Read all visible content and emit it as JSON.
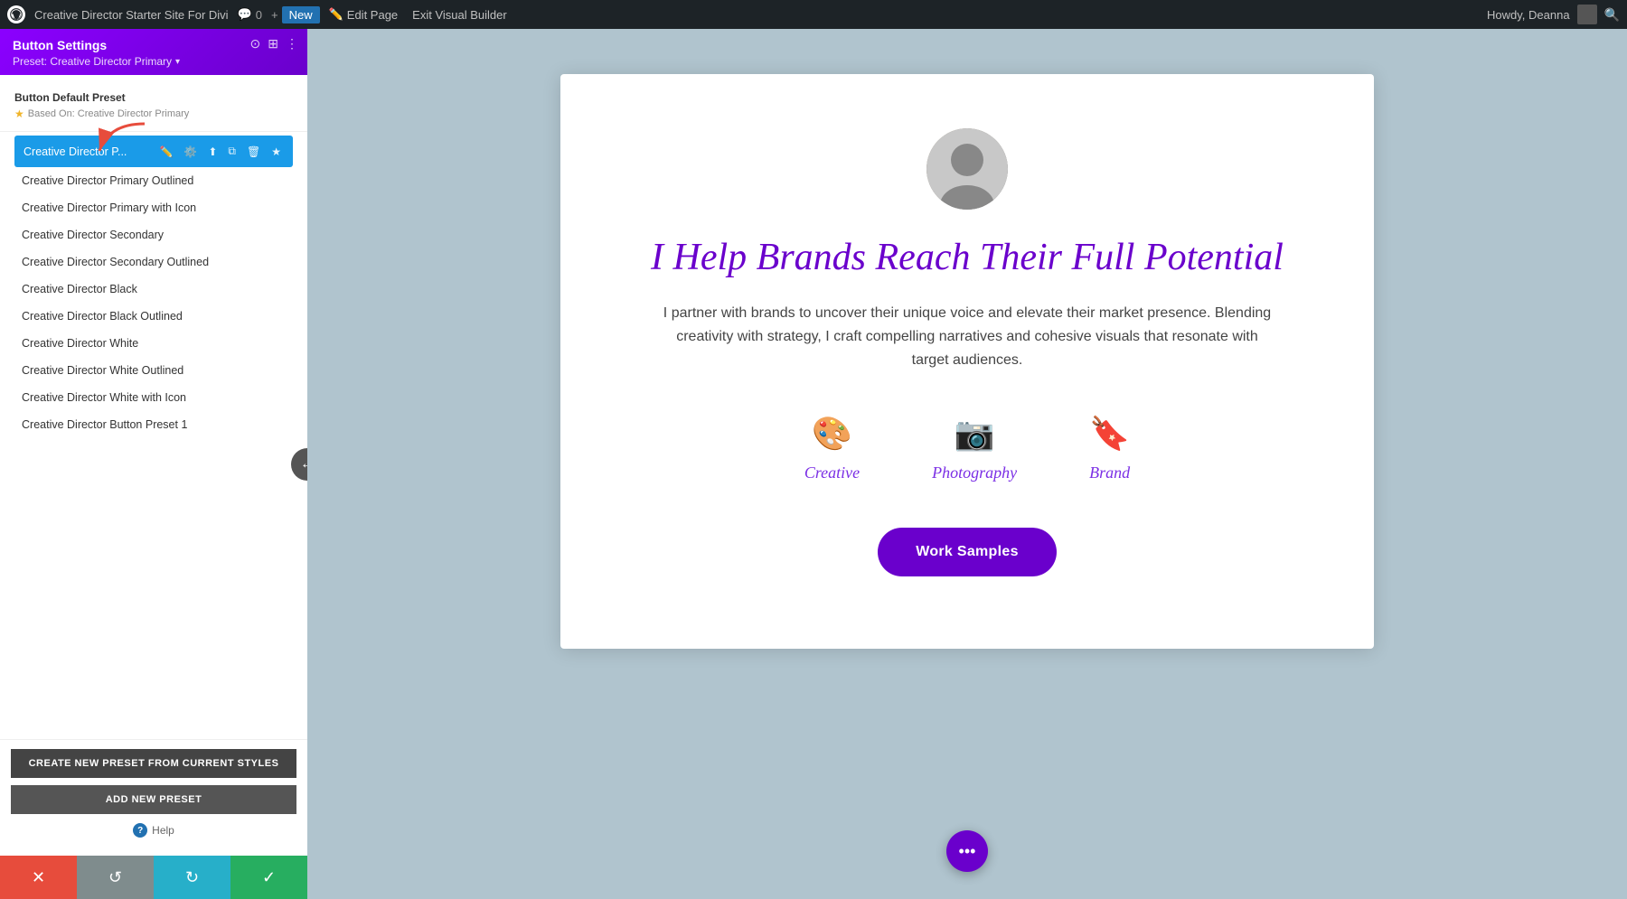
{
  "topbar": {
    "site_name": "Creative Director Starter Site For Divi",
    "comment_count": "0",
    "new_label": "New",
    "edit_page_label": "Edit Page",
    "exit_builder_label": "Exit Visual Builder",
    "howdy_label": "Howdy, Deanna",
    "search_icon": "🔍"
  },
  "panel": {
    "title": "Button Settings",
    "preset_label": "Preset: Creative Director Primary",
    "default_preset_heading": "Button Default Preset",
    "based_on": "Based On: Creative Director Primary",
    "active_preset": "Creative Director P...",
    "presets": [
      {
        "id": "cdp",
        "label": "Creative Director Primary Outlined"
      },
      {
        "id": "cdpi",
        "label": "Creative Director Primary with Icon"
      },
      {
        "id": "cds",
        "label": "Creative Director Secondary"
      },
      {
        "id": "cdso",
        "label": "Creative Director Secondary Outlined"
      },
      {
        "id": "cdb",
        "label": "Creative Director Black"
      },
      {
        "id": "cdbo",
        "label": "Creative Director Black Outlined"
      },
      {
        "id": "cdw",
        "label": "Creative Director White"
      },
      {
        "id": "cdwo",
        "label": "Creative Director White Outlined"
      },
      {
        "id": "cdwi",
        "label": "Creative Director White with Icon"
      },
      {
        "id": "cdbp",
        "label": "Creative Director Button Preset 1"
      }
    ],
    "create_preset_btn": "CREATE NEW PRESET FROM CURRENT STYLES",
    "add_preset_btn": "ADD NEW PRESET",
    "help_label": "Help"
  },
  "canvas": {
    "hero_title": "I Help Brands Reach Their Full Potential",
    "hero_description": "I partner with brands to uncover their unique voice and elevate their market presence. Blending creativity with strategy, I craft compelling narratives and cohesive visuals that resonate with target audiences.",
    "services": [
      {
        "id": "creative",
        "label": "Creative",
        "icon": "🎨"
      },
      {
        "id": "photography",
        "label": "Photography",
        "icon": "📷"
      },
      {
        "id": "brand",
        "label": "Brand",
        "icon": "🔖"
      }
    ],
    "cta_label": "Work Samples"
  },
  "bottombar": {
    "cancel_icon": "✕",
    "undo_icon": "↺",
    "redo_icon": "↻",
    "save_icon": "✓"
  },
  "colors": {
    "accent_purple": "#6a00cc",
    "active_blue": "#1a9be8",
    "topbar_bg": "#1d2327",
    "panel_header_gradient_start": "#8b00ff",
    "panel_header_gradient_end": "#6a00cc"
  }
}
